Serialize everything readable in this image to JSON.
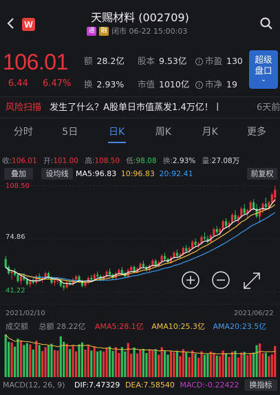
{
  "header": {
    "title": "天赐材料 (002709)",
    "logo_letter": "W",
    "tags": [
      "通",
      "融"
    ],
    "status": "闭市 06-22 15:00:03"
  },
  "quote": {
    "price": "106.01",
    "change": "6.44",
    "change_pct": "6.47%",
    "amount_label": "额",
    "amount": "28.2亿",
    "share_label": "股本",
    "share": "9.53亿",
    "pe_label": "市盈",
    "pe": "130",
    "turnover_label": "换",
    "turnover": "2.93%",
    "mcap_label": "市值",
    "mcap": "1010亿",
    "pb_label": "市净",
    "pb": "19",
    "super_btn_l1": "超级",
    "super_btn_l2": "盘口"
  },
  "news": {
    "tag": "风险扫描",
    "text": "发生了什么？A股单日市值蒸发1.4万亿！丨",
    "time": "6天前"
  },
  "tabs": [
    "分时",
    "5日",
    "日K",
    "周K",
    "月K",
    "更多"
  ],
  "active_tab": 2,
  "ohlc": {
    "close_label": "收:",
    "close": "106.01",
    "open_label": "开:",
    "open": "101.00",
    "high_label": "高:",
    "high": "108.50",
    "low_label": "低:",
    "low": "98.08",
    "turn_label": "换:",
    "turn": "2.93%",
    "vol_label": "量:",
    "vol": "27.08万"
  },
  "toolbar": {
    "overlay": "叠加",
    "ma_line": "设均线",
    "ma5": "MA5:96.83",
    "ma10": "10:96.83",
    "ma20": "20:92.41",
    "adjust": "前复权"
  },
  "price_axis": {
    "high": "108.50",
    "mid": "74.86",
    "low": "41.22"
  },
  "dates": {
    "start": "2021/02/10",
    "end": "2021/06/22"
  },
  "volume": {
    "label": "成交额",
    "total": "总额 28.22亿",
    "ama5": "AMA5:28.1亿",
    "ama10": "AMA10:25.3亿",
    "ama20": "AMA20:23.5亿"
  },
  "macd": {
    "label": "MACD(12, 26, 9)",
    "dif": "DIF:7.47329",
    "dea": "DEA:7.58540",
    "macd": "MACD:-0.22422",
    "switch": "换指标"
  },
  "colors": {
    "up": "#e8343b",
    "down": "#2fc25b",
    "ma5": "#ffffff",
    "ma10": "#f5c242",
    "ma20": "#3d9bf0",
    "accent": "#4a86e8"
  },
  "chart_data": {
    "type": "candlestick",
    "x_start": "2021/02/10",
    "x_end": "2021/06/22",
    "ylim": [
      41.22,
      108.5
    ],
    "candles": [
      [
        62,
        64,
        56,
        57
      ],
      [
        57,
        58,
        52,
        53
      ],
      [
        53,
        55,
        49,
        54
      ],
      [
        54,
        56,
        51,
        52
      ],
      [
        52,
        53,
        47,
        48
      ],
      [
        48,
        52,
        46,
        51
      ],
      [
        51,
        53,
        48,
        49
      ],
      [
        49,
        50,
        45,
        46
      ],
      [
        46,
        49,
        44,
        48
      ],
      [
        48,
        50,
        46,
        47
      ],
      [
        47,
        52,
        46,
        51
      ],
      [
        51,
        53,
        48,
        49
      ],
      [
        49,
        51,
        47,
        50
      ],
      [
        50,
        54,
        49,
        53
      ],
      [
        53,
        54,
        49,
        50
      ],
      [
        50,
        51,
        46,
        47
      ],
      [
        47,
        49,
        45,
        48
      ],
      [
        48,
        50,
        46,
        49
      ],
      [
        49,
        50,
        44,
        45
      ],
      [
        45,
        47,
        42,
        44
      ],
      [
        44,
        48,
        43,
        47
      ],
      [
        47,
        49,
        45,
        46
      ],
      [
        46,
        50,
        45,
        49
      ],
      [
        49,
        52,
        48,
        51
      ],
      [
        51,
        52,
        47,
        48
      ],
      [
        48,
        49,
        44,
        45
      ],
      [
        45,
        48,
        44,
        47
      ],
      [
        47,
        51,
        46,
        50
      ],
      [
        50,
        52,
        48,
        49
      ],
      [
        49,
        53,
        48,
        52
      ],
      [
        52,
        54,
        50,
        51
      ],
      [
        51,
        52,
        48,
        49
      ],
      [
        49,
        52,
        48,
        51
      ],
      [
        51,
        55,
        50,
        54
      ],
      [
        54,
        56,
        51,
        52
      ],
      [
        52,
        53,
        49,
        50
      ],
      [
        50,
        54,
        49,
        53
      ],
      [
        53,
        56,
        52,
        55
      ],
      [
        55,
        57,
        52,
        53
      ],
      [
        53,
        54,
        50,
        51
      ],
      [
        51,
        56,
        50,
        55
      ],
      [
        55,
        58,
        54,
        57
      ],
      [
        57,
        58,
        53,
        54
      ],
      [
        54,
        57,
        53,
        56
      ],
      [
        56,
        60,
        55,
        59
      ],
      [
        59,
        61,
        56,
        57
      ],
      [
        57,
        58,
        54,
        55
      ],
      [
        55,
        59,
        54,
        58
      ],
      [
        58,
        62,
        57,
        61
      ],
      [
        61,
        62,
        57,
        58
      ],
      [
        58,
        61,
        57,
        60
      ],
      [
        60,
        65,
        59,
        64
      ],
      [
        64,
        66,
        61,
        62
      ],
      [
        62,
        63,
        59,
        60
      ],
      [
        60,
        64,
        59,
        63
      ],
      [
        63,
        67,
        62,
        66
      ],
      [
        66,
        68,
        63,
        64
      ],
      [
        64,
        66,
        62,
        65
      ],
      [
        65,
        70,
        64,
        69
      ],
      [
        69,
        71,
        66,
        67
      ],
      [
        67,
        70,
        66,
        69
      ],
      [
        69,
        74,
        68,
        73
      ],
      [
        73,
        75,
        70,
        71
      ],
      [
        71,
        73,
        69,
        72
      ],
      [
        72,
        77,
        71,
        76
      ],
      [
        76,
        79,
        74,
        75
      ],
      [
        75,
        77,
        72,
        73
      ],
      [
        73,
        78,
        72,
        77
      ],
      [
        77,
        82,
        76,
        81
      ],
      [
        81,
        83,
        78,
        79
      ],
      [
        79,
        82,
        77,
        81
      ],
      [
        81,
        87,
        80,
        86
      ],
      [
        86,
        88,
        82,
        83
      ],
      [
        83,
        86,
        81,
        85
      ],
      [
        85,
        91,
        84,
        90
      ],
      [
        90,
        93,
        86,
        87
      ],
      [
        87,
        90,
        85,
        89
      ],
      [
        89,
        95,
        88,
        94
      ],
      [
        94,
        97,
        90,
        91
      ],
      [
        91,
        94,
        88,
        93
      ],
      [
        93,
        99,
        92,
        98
      ],
      [
        98,
        100,
        93,
        94
      ],
      [
        94,
        97,
        88,
        89
      ],
      [
        89,
        95,
        85,
        93
      ],
      [
        93,
        98,
        91,
        97
      ],
      [
        97,
        101,
        94,
        95
      ],
      [
        95,
        99,
        93,
        98
      ],
      [
        98,
        104,
        97,
        103
      ],
      [
        101,
        108.5,
        98.08,
        106.01
      ]
    ]
  }
}
